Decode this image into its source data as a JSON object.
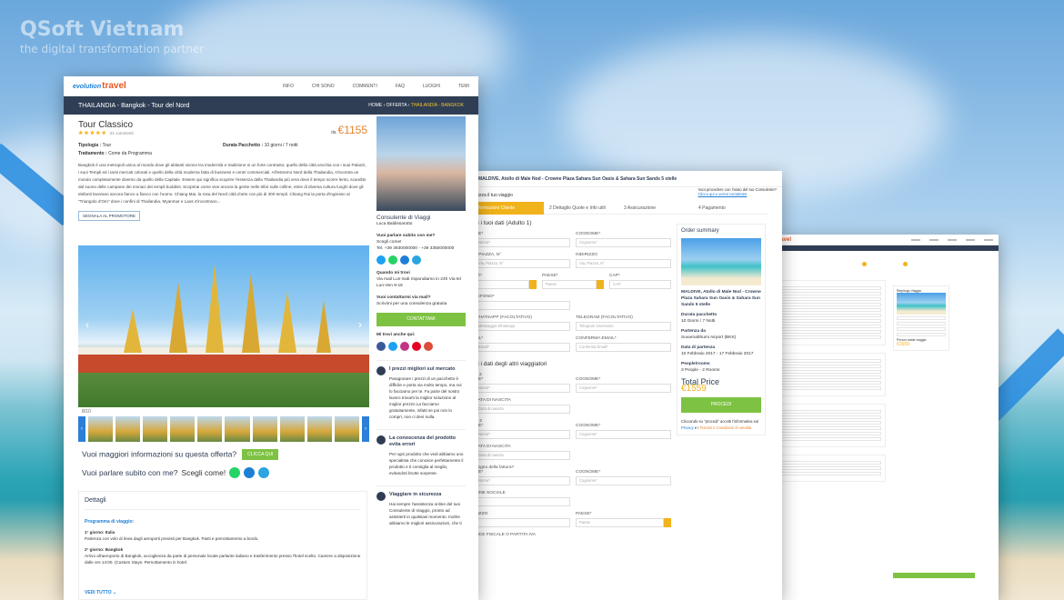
{
  "watermark": {
    "brand": "QSoft Vietnam",
    "tagline": "the digital transformation partner"
  },
  "w1": {
    "logo_prefix": "evolution",
    "logo": "travel",
    "nav": [
      "INFO",
      "CHI SONO",
      "COMMENTI",
      "FAQ",
      "LUOGHI",
      "TEMI"
    ],
    "header_title": "THAILANDIA - Bangkok - Tour del Nord",
    "crumb_home": "HOME",
    "crumb_offerta": "OFFERTA",
    "crumb_current": "THAILANDIA - BANGKOK",
    "tour_title": "Tour Classico",
    "stars": "★★★★★",
    "reviews": "21 commenti",
    "price_from": "da",
    "price": "€1155",
    "tipologia_label": "Tipologia :",
    "tipologia": "Tour",
    "durata_label": "Durata Pacchetto :",
    "durata": "10 giorni / 7 notti",
    "trattamento_label": "Trattamento :",
    "trattamento": "Come da Programma",
    "description": "Bangkok è una metropoli unica al mondo dove gli abitanti vivono tra modernità e tradizione in un forte contrasto; quello della città vecchia con i suoi Palazzi, i suoi Templi ed i tanti mercati colorati e quello della città moderna fatta di business e centri commerciali. All'estremo Nord della Thailandia, s'incontra un mondo completamente diverso da quello della Capitale. Essere qui significa scoprire l'essenza della Thailandia più vera dove il tempo scorre lento, scandito dal suono delle campane dei monaci dei templi buddisti. Scoprirai come vive ancora la gente nelle tribù sulle colline, etnie di diversa cultura luoghi dove gli elefanti lavorano ancora fianco a fianco con l'uomo. Chiang Mai, la rosa del Nord città d'arte con più di 300 templi. Chiang Rai la porta d'ingresso al \"Triangolo d'Oro\" dove i confini di Thailandia, Myanmar e Laos s'incontrano...",
    "report_btn": "SEGNALA AL PROMOTORE",
    "gallery_counter": "8/10",
    "cta_more": "Vuoi maggiori informazioni su questa offerta?",
    "cta_click": "CLICCA QUI",
    "cta_talk": "Vuoi parlare subito con me?",
    "cta_choose": "Scegli come!",
    "details_title": "Dettagli",
    "program_title": "Programma di viaggio:",
    "day1_title": "1° giorno: Italia",
    "day1": "Partenza con volo di linea dagli aeroporti previsti per Bangkok. Pasti e pernottamento a bordo.",
    "day2_title": "2° giorno: Bangkok",
    "day2": "Arrivo all'aeroporto di Bangkok, accoglienza da parte di personale locale parlante italiano e trasferimento presso l'hotel scelto. Camere a disposizione dalle ore 14:00. (Custom Stays. Pernottamento in hotel.",
    "see_all": "VEDI TUTTO ⌄",
    "agent_title": "Consulente di Viaggi",
    "agent_name": "Luca Baldissarotto",
    "talk_h": "Vuoi parlare subito con me?",
    "talk_sub": "Scegli come!",
    "tel": "Tel. +39 3930000000 - +39 3350000000",
    "when_h": "Quando mi trovi",
    "when": "Via mail Lun-Sab rispondiamo in 24h Via tel Lun-Ven 9-16",
    "mail_h": "Vuoi contattarmi via mail?",
    "mail_sub": "Scrivimi per una consulenza gratuita",
    "contact_btn": "CONTATTAMI",
    "find_h": "Mi trovi anche qui:",
    "f1_title": "I prezzi migliori sul mercato",
    "f1": "Paragonare i prezzi di un pacchetto è difficile e porta via molto tempo, ma noi lo facciamo per te. Fa parte del nostro lavoro trovarti la miglior soluzione al miglior prezzo La facciamo gratuitamente, infatti se poi non lo compri, non ci devi nulla.",
    "f2_title": "La conoscenza del prodotto evita errori",
    "f2": "Per ogni prodotto che vedi abbiamo uno specialista che conosce perfettamente il prodotto e ti consiglia al meglio, evitandoti brutte sorprese.",
    "f3_title": "Viaggiare in sicurezza",
    "f3": "Hai sempre l'assistenza online del tuoi Consulente di Viaggio, pronto ad assisterti in qualsiasi momento. Inoltre abbiamo le migliori assicurazioni, che ti"
  },
  "w2": {
    "title": "MALDIVE, Atollo di Male Nod - Crowne Plaza Sahara Sun Oasis & Sahara Sun Sands 5 stelle",
    "help": "Vuoi procedere con l'aiuto del tuo Consulente?",
    "help_link": "Clicca qui e verrai contattato!",
    "start": "alizza il tuo viaggio",
    "steps": [
      "Informazioni Cliente",
      "2  Dettaglio Quote e Info utili",
      "3  Assicurazione",
      "4  Pagamento"
    ],
    "sec1": "ci i tuoi dati (Adulto 1)",
    "lbl_nome": "ME*",
    "ph_nome": "Nome*",
    "lbl_cognome": "COGNOME*",
    "ph_cognome": "Cognome*",
    "lbl_via": "A PIAZZA, N°",
    "ph_via": "Via, Piazza, N°",
    "lbl_ind": "INDIRIZZO",
    "ph_ind": "Via, Piazza, N°",
    "lbl_citta": "TÀ*",
    "lbl_paese": "PAESE*",
    "ph_paese": "Paese",
    "lbl_cap": "CAP*",
    "ph_cap": "CAP",
    "lbl_tel": "LEFONO*",
    "lbl_whats": "WHATSAPP (FACOLTATIVO)",
    "ph_whats": "Messaggio Whatsapp",
    "lbl_tg": "TELEGRAM (FACOLTATIVO)",
    "ph_tg": "Telegram Username",
    "lbl_mail": "AIL*",
    "ph_mail": "Email*",
    "lbl_cmail": "CONFERMA EMAIL*",
    "ph_cmail": "Conferma Email*",
    "sec2": "ci i dati degli altri viaggiatori",
    "sub2": "lo 2",
    "sub3": "lo 3",
    "lbl_data": "DATA DI NASCITA",
    "ph_data": "Data di nascita",
    "lbl_fatt": "isogno della fattura?",
    "lbl_rag": "IONE SOCIALE",
    "lbl_ind2": "RIZZO",
    "lbl_cf": "DICE FISCALE O PARTITA IVA",
    "order_title": "Order summary",
    "hotel": "MALDIVE, Atollo di Male Nod - Crowne Plaza Sahara Sun Oasis & Sahara Sun Sands 5 stelle",
    "dur_h": "Durata pacchetto",
    "dur": "10 Giorni / 7 Notti",
    "part_h": "Partenza da",
    "part": "Suvarnabhumi Airport (BKK)",
    "date_h": "Data di partenza",
    "date": "10 Febbraio 2017  -  17 Febbraio 2017",
    "people_h": "People/rooms",
    "people": "3 People - 2 Rooms",
    "total_h": "Total Price",
    "total": "€1559",
    "proceed": "PROCEDI",
    "note": "Cliccando su \"procedi\" accetti l'informativa sul",
    "note_priv": "Privacy",
    "note_and": "e i",
    "note_terms": "Termini e Condizioni di vendita"
  },
  "w3": {
    "logo": "travel",
    "summary": "Riepilogo Viaggio",
    "price": "€1559",
    "price_h": "Prezzo totale viaggio"
  },
  "colors": {
    "accent": "#f1b31c",
    "primary": "#2f3e54",
    "green": "#7dc242",
    "link": "#1e7fd6"
  }
}
